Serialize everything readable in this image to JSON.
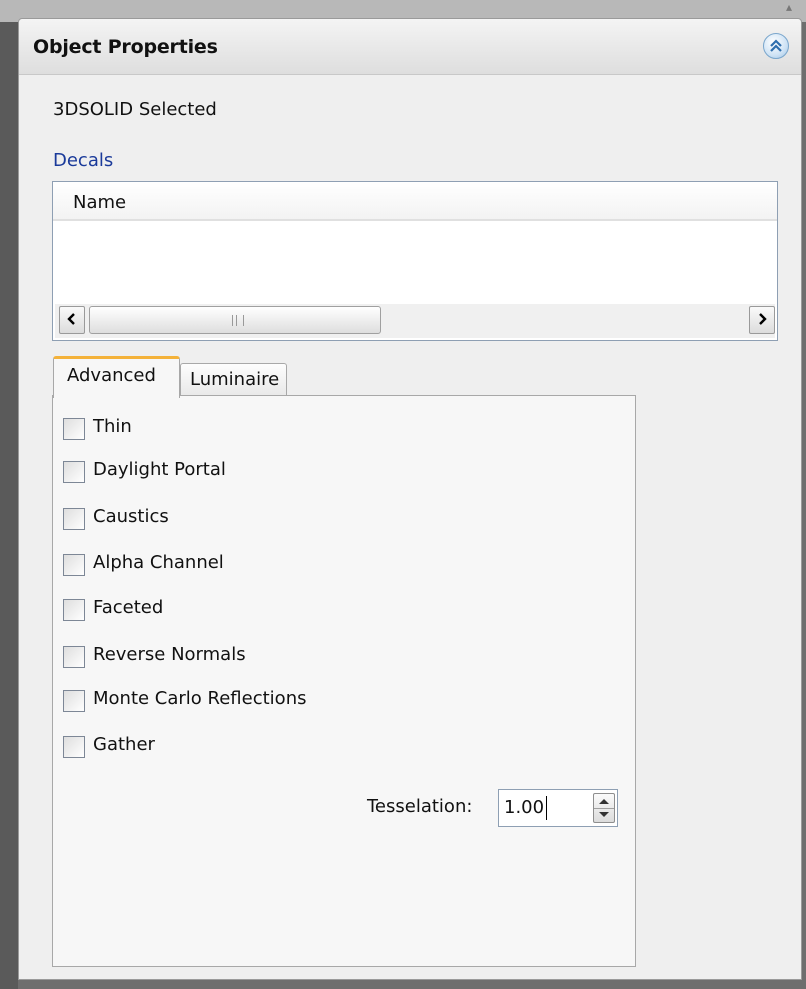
{
  "panel": {
    "title": "Object Properties",
    "selected_text": "3DSOLID Selected"
  },
  "decals": {
    "label": "Decals",
    "columns": [
      "Name"
    ],
    "rows": []
  },
  "tabs": [
    {
      "label": "Advanced",
      "active": true
    },
    {
      "label": "Luminaire",
      "active": false
    }
  ],
  "advanced": {
    "checkboxes": [
      {
        "label": "Thin",
        "checked": false
      },
      {
        "label": "Daylight Portal",
        "checked": false
      },
      {
        "label": "Caustics",
        "checked": false
      },
      {
        "label": "Alpha Channel",
        "checked": false
      },
      {
        "label": "Faceted",
        "checked": false
      },
      {
        "label": "Reverse Normals",
        "checked": false
      },
      {
        "label": "Monte Carlo Reflections",
        "checked": false
      },
      {
        "label": "Gather",
        "checked": false
      }
    ],
    "tesselation_label": "Tesselation:",
    "tesselation_value": "1.00"
  },
  "icons": {
    "collapse": "chevron-double-up-icon",
    "scroll_left": "arrow-left-icon",
    "scroll_right": "arrow-right-icon"
  }
}
